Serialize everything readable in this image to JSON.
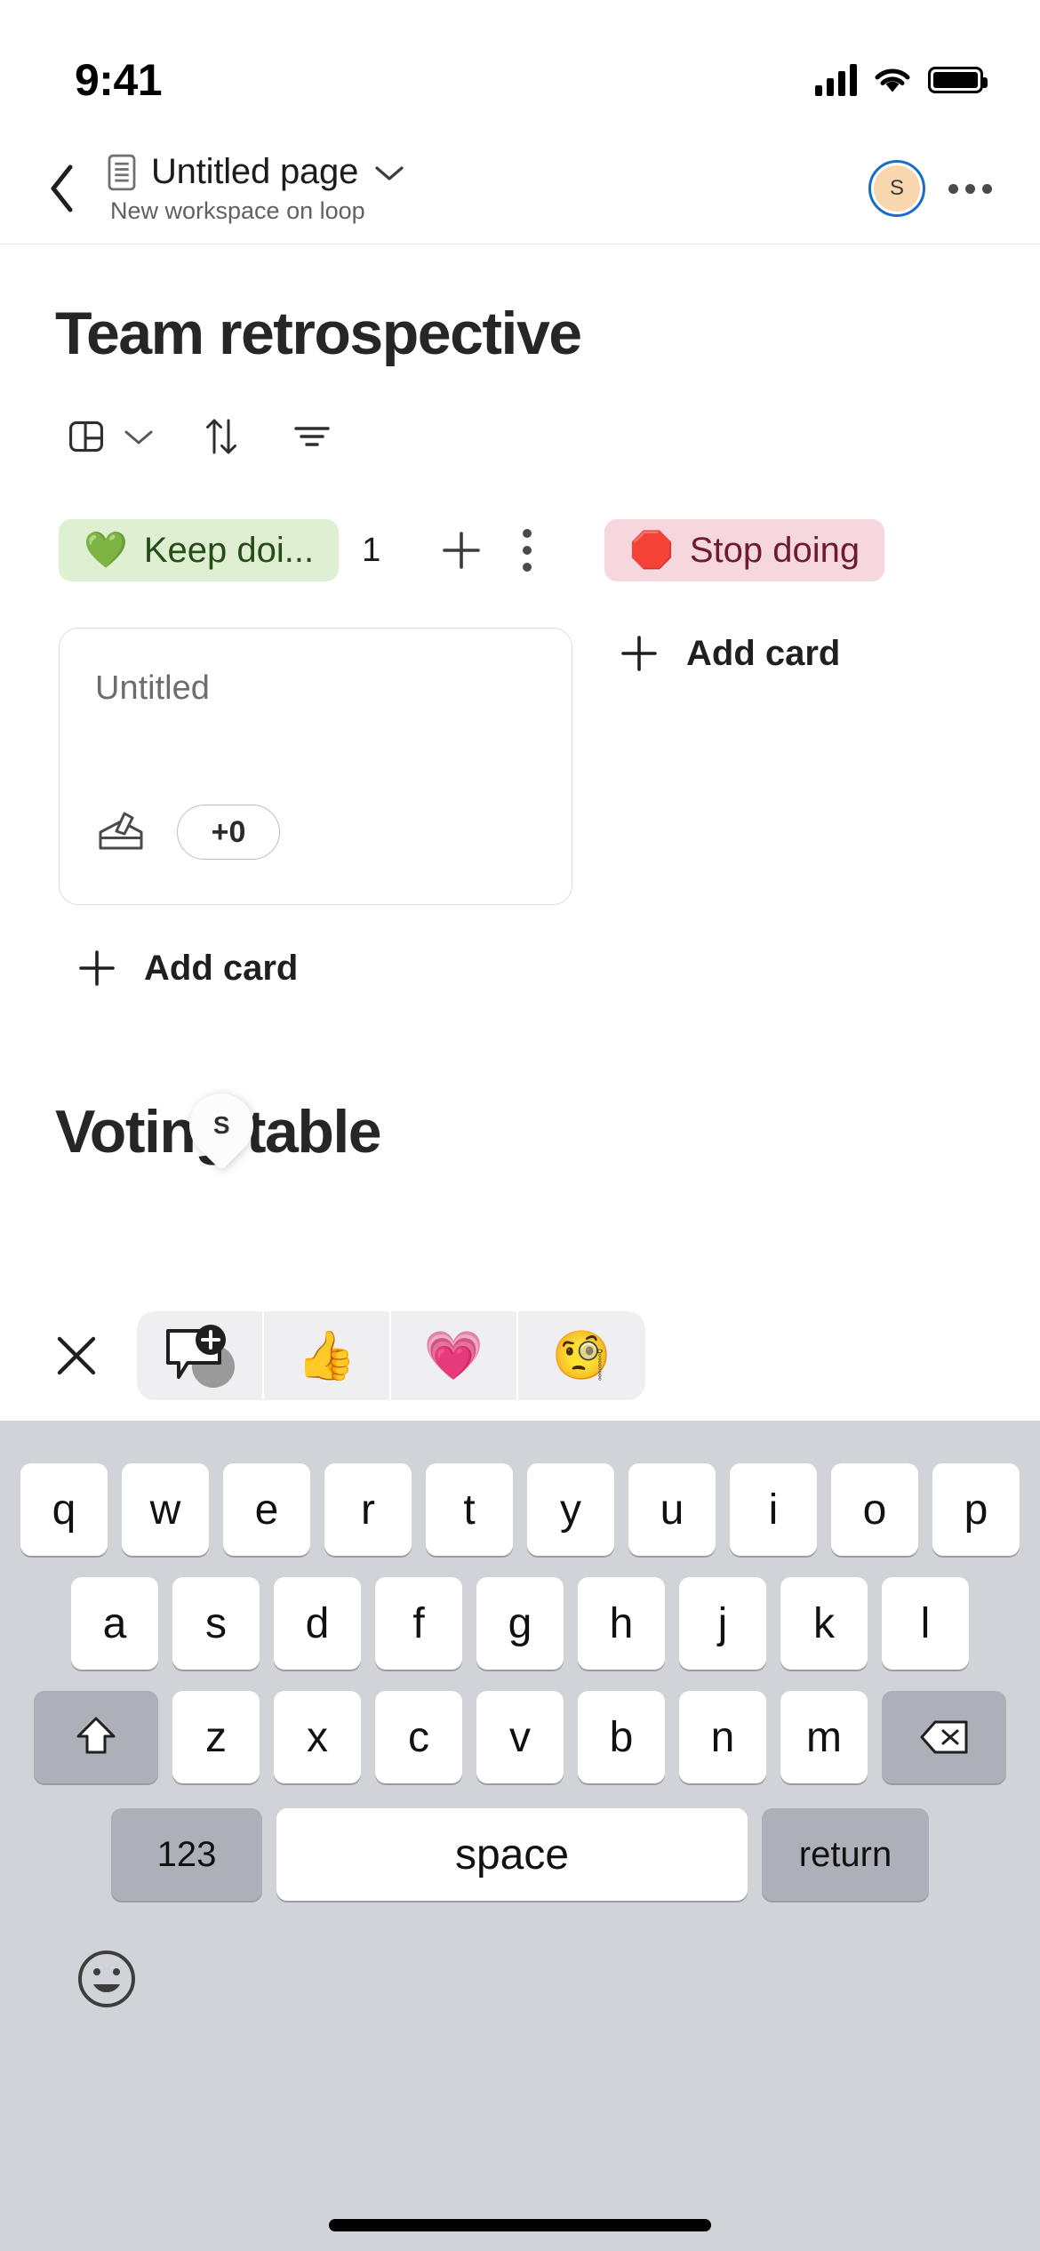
{
  "status_bar": {
    "time": "9:41",
    "cellular_icon": "signal-bars-icon",
    "wifi_icon": "wifi-icon",
    "battery_icon": "battery-full-icon"
  },
  "nav": {
    "back_icon": "chevron-left-icon",
    "doc_icon": "document-icon",
    "title": "Untitled page",
    "title_chevron_icon": "chevron-down-icon",
    "subtitle": "New workspace on loop",
    "avatar_initial": "S",
    "more_icon": "more-horizontal-icon"
  },
  "page": {
    "title": "Team retrospective",
    "toolbar": {
      "view_icon": "board-view-icon",
      "view_chevron_icon": "chevron-down-icon",
      "sort_icon": "sort-arrows-icon",
      "filter_icon": "filter-icon"
    },
    "board": {
      "columns": [
        {
          "emoji": "💚",
          "name": "Keep doi...",
          "count": "1",
          "pill_color": "#dff0d2",
          "text_color": "#264d18",
          "add_icon": "plus-icon",
          "menu_icon": "more-vertical-icon",
          "cards": [
            {
              "title": "Untitled",
              "vote_icon": "ballot-box-icon",
              "vote_count": "+0"
            }
          ],
          "add_card_label": "Add card",
          "add_card_icon": "plus-icon"
        },
        {
          "emoji": "🛑",
          "name": "Stop doing",
          "count": "",
          "pill_color": "#f6d7de",
          "text_color": "#6d1a32",
          "cards": [],
          "add_card_label": "Add card",
          "add_card_icon": "plus-icon"
        }
      ]
    },
    "section_two": {
      "title": "Voting table",
      "presence_initial": "S"
    }
  },
  "reaction_bar": {
    "close_icon": "close-x-icon",
    "items": [
      {
        "icon": "add-comment-icon",
        "emoji": ""
      },
      {
        "icon": "thumbs-up-emoji",
        "emoji": "👍"
      },
      {
        "icon": "heart-emoji",
        "emoji": "💗"
      },
      {
        "icon": "thinking-face-emoji",
        "emoji": "🧐"
      }
    ]
  },
  "keyboard": {
    "row1": [
      "q",
      "w",
      "e",
      "r",
      "t",
      "y",
      "u",
      "i",
      "o",
      "p"
    ],
    "row2": [
      "a",
      "s",
      "d",
      "f",
      "g",
      "h",
      "j",
      "k",
      "l"
    ],
    "row3": [
      "z",
      "x",
      "c",
      "v",
      "b",
      "n",
      "m"
    ],
    "shift_icon": "shift-arrow-icon",
    "backspace_icon": "backspace-icon",
    "numbers_label": "123",
    "space_label": "space",
    "return_label": "return",
    "emoji_key_icon": "emoji-smiley-icon"
  }
}
